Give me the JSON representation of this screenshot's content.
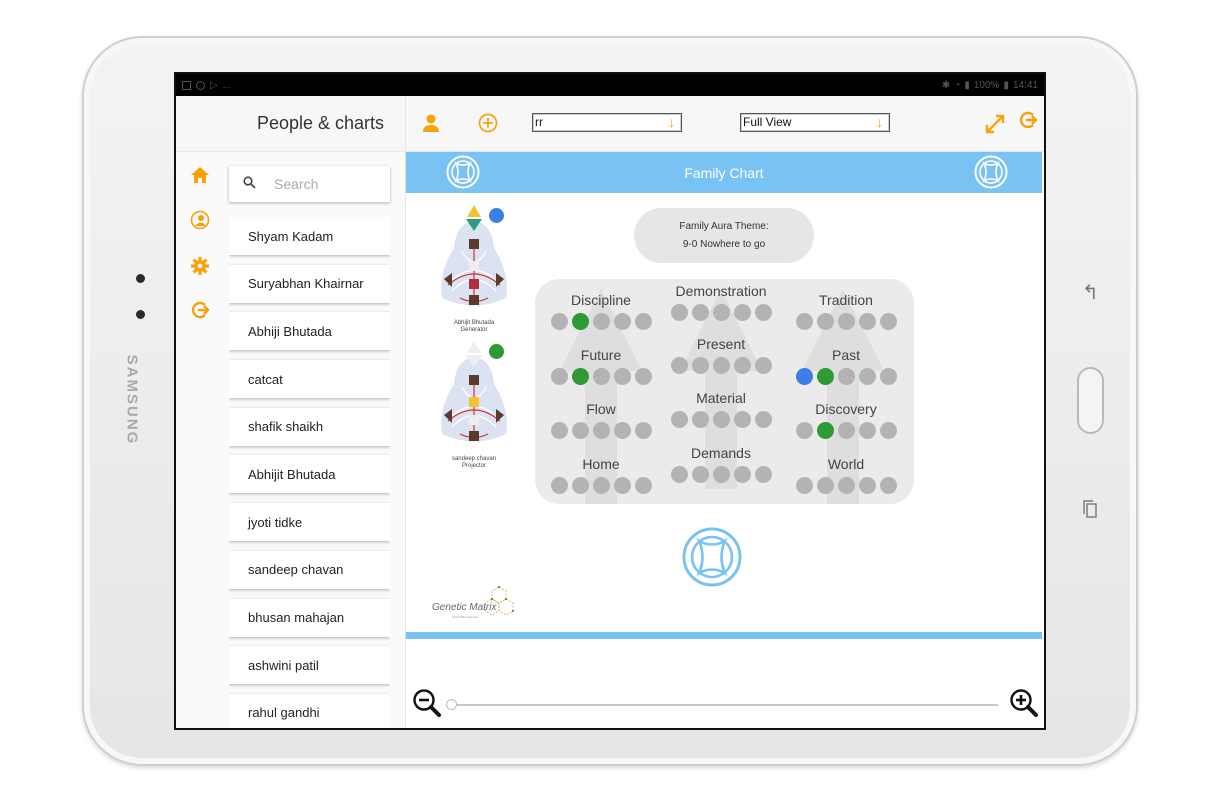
{
  "device": {
    "brand": "SAMSUNG",
    "status_bar": {
      "left_icons": [
        "gallery-icon",
        "clock-icon",
        "play-icon"
      ],
      "more": "...",
      "battery": "100%",
      "time": "14:41"
    }
  },
  "left_pane": {
    "title": "People & charts",
    "nav": [
      {
        "icon": "home-icon",
        "glyph": "⌂"
      },
      {
        "icon": "profile-circle-icon",
        "glyph": "☺"
      },
      {
        "icon": "gear-icon",
        "glyph": "⚙"
      },
      {
        "icon": "logout-icon",
        "glyph": "↪"
      }
    ],
    "search": {
      "placeholder": "Search",
      "value": ""
    },
    "people": [
      "Shyam Kadam",
      "Suryabhan Khairnar",
      "Abhiji Bhutada",
      "catcat",
      "shafik shaikh",
      "Abhijit Bhutada",
      "jyoti tidke",
      "sandeep chavan",
      "bhusan mahajan",
      "ashwini patil",
      "rahul gandhi"
    ]
  },
  "toolbar": {
    "chart_select": {
      "value": "rr"
    },
    "view_select": {
      "value": "Full View"
    },
    "colors": {
      "accent": "#f5a20b"
    }
  },
  "chart": {
    "header_title": "Family Chart",
    "header_color": "#78c2f4",
    "members": [
      {
        "name": "Abhijit Bhutada",
        "type": "Generator",
        "color": "#3d7de6"
      },
      {
        "name": "sandeep chavan",
        "type": "Projector",
        "color": "#2e9a34"
      }
    ],
    "aura_theme": {
      "label": "Family Aura Theme:",
      "value": "9-0 Nowhere to go"
    },
    "cells": [
      {
        "label": "Discipline",
        "active": [
          null,
          "#2e9a34",
          null,
          null,
          null
        ]
      },
      {
        "label": "Demonstration",
        "active": [
          null,
          null,
          null,
          null,
          null
        ]
      },
      {
        "label": "Tradition",
        "active": [
          null,
          null,
          null,
          null,
          null
        ]
      },
      {
        "label": "Future",
        "active": [
          null,
          "#2e9a34",
          null,
          null,
          null
        ]
      },
      {
        "label": "Present",
        "active": [
          null,
          null,
          null,
          null,
          null
        ]
      },
      {
        "label": "Past",
        "active": [
          "#3d7de6",
          "#2e9a34",
          null,
          null,
          null
        ]
      },
      {
        "label": "Flow",
        "active": [
          null,
          null,
          null,
          null,
          null
        ]
      },
      {
        "label": "Material",
        "active": [
          null,
          null,
          null,
          null,
          null
        ]
      },
      {
        "label": "Discovery",
        "active": [
          null,
          "#2e9a34",
          null,
          null,
          null
        ]
      },
      {
        "label": "Home",
        "active": [
          null,
          null,
          null,
          null,
          null
        ]
      },
      {
        "label": "Demands",
        "active": [
          null,
          null,
          null,
          null,
          null
        ]
      },
      {
        "label": "World",
        "active": [
          null,
          null,
          null,
          null,
          null
        ]
      }
    ],
    "brand_logo_text": "Genetic Matrix",
    "brand_logo_tagline": "Know Who You Are"
  },
  "zoom": {
    "value": 0
  }
}
